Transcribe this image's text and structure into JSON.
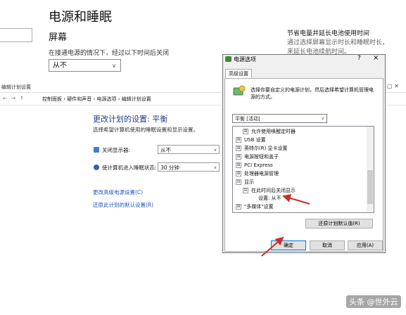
{
  "settings": {
    "title": "电源和睡眠",
    "screen_heading": "屏幕",
    "plugged_desc": "在接通电源的情况下，经过以下时间后关闭",
    "screen_value": "从不",
    "right_title": "节省电量并延长电池使用时间",
    "right_desc": "通过选择屏幕显示时长和睡眠时长，来延长电池续航时间。"
  },
  "control_panel": {
    "window_title": "编辑计划设置",
    "breadcrumbs": "控制面板  ›  硬件和声音  ›  电源选项  ›  编辑计划设置",
    "heading": "更改计划的设置: 平衡",
    "subheading": "选择希望计算机使用的睡眠设置和显示设置。",
    "rows": [
      {
        "label": "关闭显示器:",
        "value": "从不"
      },
      {
        "label": "使计算机进入睡眠状态:",
        "value": "30 分钟"
      }
    ],
    "link_advanced": "更改高级电源设置(C)",
    "link_restore": "还原此计划的默认设置(R)"
  },
  "dialog": {
    "title": "电源选项",
    "help": "?",
    "close": "×",
    "tab": "高级设置",
    "desc": "选择你要自定义的电源计划，然后选择希望计算机管理电源的方式。",
    "plan_value": "平衡 [活动]",
    "tree": [
      {
        "text": "允许使用唤醒定时器",
        "expander": "⊞"
      },
      {
        "text": "USB 设置",
        "expander": "⊞"
      },
      {
        "text": "英特尔(R) 显卡设置",
        "expander": "⊞"
      },
      {
        "text": "电源按钮和盖子",
        "expander": "⊞"
      },
      {
        "text": "PCI Express",
        "expander": "⊞"
      },
      {
        "text": "处理器电源管理",
        "expander": "⊞"
      },
      {
        "text": "显示",
        "expander": "⊟"
      },
      {
        "text": "在此时间后关闭显示",
        "expander": "⊟"
      },
      {
        "text": "设置: 从不",
        "expander": ""
      },
      {
        "text": "\"多媒体\"设置",
        "expander": "⊞"
      }
    ],
    "restore_button": "还原计划默认值(R)",
    "ok_button": "确定",
    "cancel_button": "取消",
    "apply_button": "应用(A)"
  },
  "watermark": "头条 @世外云",
  "colors": {
    "link": "#1f57c3",
    "heading": "#1e3d8f",
    "arrow": "#c8302a",
    "focus": "#0078d7"
  }
}
